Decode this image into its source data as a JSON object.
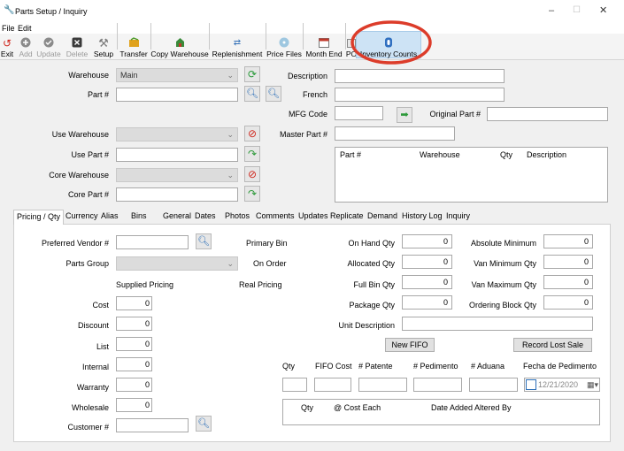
{
  "window": {
    "title": "Parts Setup / Inquiry",
    "minimize": "–",
    "maximize": "☐",
    "close": "✕"
  },
  "menu": {
    "file": "File",
    "edit": "Edit"
  },
  "toolbar": {
    "exit": "Exit",
    "add": "Add",
    "update": "Update",
    "delete": "Delete",
    "setup": "Setup",
    "transfer": "Transfer",
    "copy_warehouse": "Copy Warehouse",
    "replenishment": "Replenishment",
    "price_files": "Price Files",
    "month_end": "Month End",
    "po": "PO",
    "inventory_counts": "Inventory Counts"
  },
  "header": {
    "warehouse_label": "Warehouse",
    "warehouse_value": "Main",
    "part_label": "Part #",
    "part_value": "",
    "description_label": "Description",
    "description_value": "",
    "french_label": "French",
    "french_value": "",
    "mfg_label": "MFG Code",
    "mfg_value": "",
    "original_part_label": "Original Part #",
    "original_part_value": "",
    "use_warehouse_label": "Use Warehouse",
    "use_warehouse_value": "",
    "master_part_label": "Master Part #",
    "master_part_value": "",
    "use_part_label": "Use Part #",
    "use_part_value": "",
    "core_warehouse_label": "Core Warehouse",
    "core_warehouse_value": "",
    "core_part_label": "Core Part #",
    "core_part_value": ""
  },
  "master_grid": {
    "columns": [
      "Part #",
      "Warehouse",
      "Qty",
      "Description"
    ]
  },
  "tabs": [
    "Pricing / Qty",
    "Currency",
    "Alias",
    "Bins",
    "General",
    "Dates",
    "Photos",
    "Comments",
    "Updates",
    "Replicate",
    "Demand",
    "History Log",
    "Inquiry"
  ],
  "pricing": {
    "preferred_vendor_label": "Preferred Vendor #",
    "preferred_vendor_value": "",
    "parts_group_label": "Parts Group",
    "parts_group_value": "",
    "supplied_pricing": "Supplied Pricing",
    "real_pricing": "Real Pricing",
    "primary_bin": "Primary Bin",
    "on_order": "On Order",
    "cost_label": "Cost",
    "cost": "0",
    "discount_label": "Discount",
    "discount": "0",
    "list_label": "List",
    "list": "0",
    "internal_label": "Internal",
    "internal": "0",
    "warranty_label": "Warranty",
    "warranty": "0",
    "wholesale_label": "Wholesale",
    "wholesale": "0",
    "customer_label": "Customer #",
    "customer_value": ""
  },
  "quantities": {
    "on_hand_label": "On Hand Qty",
    "on_hand": "0",
    "allocated_label": "Allocated Qty",
    "allocated": "0",
    "full_bin_label": "Full Bin Qty",
    "full_bin": "0",
    "package_label": "Package Qty",
    "package": "0",
    "unit_desc_label": "Unit Description",
    "unit_desc_value": "",
    "abs_min_label": "Absolute Minimum",
    "abs_min": "0",
    "van_min_label": "Van Minimum Qty",
    "van_min": "0",
    "van_max_label": "Van Maximum Qty",
    "van_max": "0",
    "ordering_block_label": "Ordering Block Qty",
    "ordering_block": "0"
  },
  "fifo": {
    "new_fifo": "New FIFO",
    "record_lost_sale": "Record Lost Sale",
    "columns": [
      "Qty",
      "FIFO Cost",
      "# Patente",
      "# Pedimento",
      "# Aduana",
      "Fecha de Pedimento"
    ],
    "date_value": "12/21/2020",
    "grid_columns": [
      "Qty",
      "@ Cost Each",
      "Date Added",
      "Altered By"
    ]
  }
}
